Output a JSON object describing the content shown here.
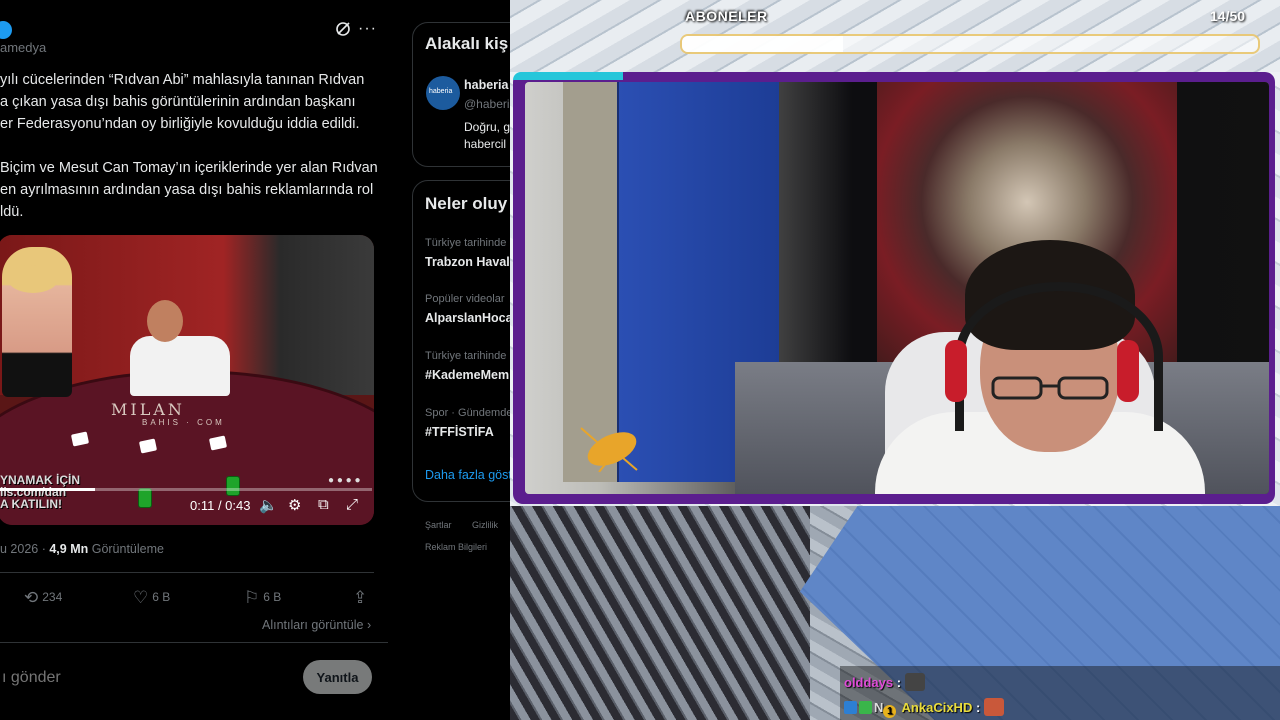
{
  "tweet": {
    "handle": "amedya",
    "body_lines": [
      "yılı cücelerinden “Rıdvan Abi” mahlasıyla tanınan Rıdvan",
      "a çıkan yasa dışı bahis görüntülerinin ardından başkanı",
      "er Federasyonu’ndan oy birliğiyle kovulduğu iddia edildi.",
      "",
      "Biçim ve Mesut Can Tomay’ın içeriklerinde yer alan Rıdvan",
      "en ayrılmasının ardından yasa dışı bahis reklamlarında rol",
      "ldü."
    ],
    "video": {
      "logo": "MILAN",
      "logo_sub": "BAHIS · COM",
      "overlay_lines": [
        "YNAMAK İÇİN",
        "iis.com/dan",
        "A KATILIN!"
      ],
      "time": "0:11 / 0:43",
      "progress": 0.256
    },
    "date_prefix": "u 2026 · ",
    "views_value": "4,9 Mn",
    "views_label": " Görüntüleme",
    "retweets": "234",
    "likes": "6 B",
    "bookmarks": "6 B",
    "view_quotes": "Alıntıları görüntüle",
    "reply_placeholder": "ı gönder",
    "reply_button": "Yanıtla"
  },
  "sidebar": {
    "related_title": "Alakalı kiş",
    "related_account": {
      "name": "haberia",
      "handle": "@haberi",
      "avatar_text": "haberia",
      "bio_lines": [
        "Doğru, g",
        "habercil"
      ]
    },
    "trends_title": "Neler oluy",
    "trends": [
      {
        "category": "Türkiye tarihinde",
        "name": "Trabzon Haval"
      },
      {
        "category": "Popüler videolar",
        "name": "AlparslanHoca"
      },
      {
        "category": "Türkiye tarihinde",
        "name": "#KademeMem"
      },
      {
        "category": "Spor · Gündemde",
        "name": "#TFFİSTİFA"
      }
    ],
    "show_more": "Daha fazla göst",
    "footer": [
      "Şartlar",
      "Gizlilik",
      "Reklam Bilgileri"
    ]
  },
  "stream": {
    "subs_label": "ABONELER",
    "subs_count": "14/50",
    "subs_progress": 0.28,
    "chat": [
      {
        "user": "olddays",
        "color": "#e04bd8",
        "message": ":"
      },
      {
        "user": "AnkaCixHD",
        "color": "#e9dc3c",
        "message": ":",
        "badge_text": "N",
        "badge_level": "1"
      }
    ]
  },
  "colors": {
    "x_background": "#000000",
    "x_text": "#e7e9ea",
    "x_muted": "#71767b",
    "x_accent": "#1d9bf0",
    "cam_frame": "#5b1e8e",
    "cam_accent": "#26c6da"
  }
}
